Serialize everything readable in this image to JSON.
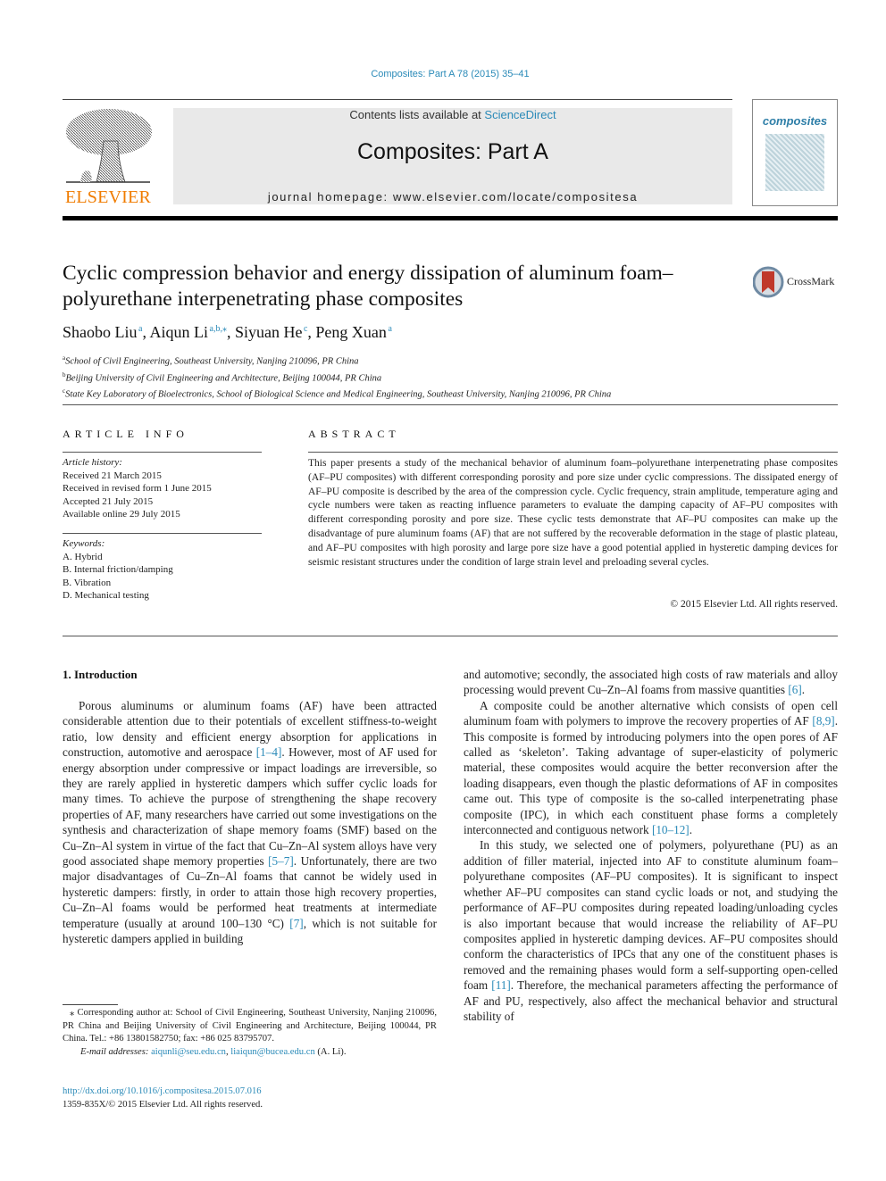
{
  "header": {
    "journal_ref": "Composites: Part A 78 (2015) 35–41",
    "contents_prefix": "Contents lists available at ",
    "contents_link": "ScienceDirect",
    "journal_title": "Composites: Part A",
    "homepage": "journal homepage: www.elsevier.com/locate/compositesa",
    "publisher_logo_text": "ELSEVIER",
    "cover_title": "composites",
    "crossmark_label": "CrossMark",
    "colors": {
      "link": "#2a8ab8",
      "elsevier_orange": "#f07c00",
      "header_bg": "#e9e9e9"
    }
  },
  "article": {
    "title": "Cyclic compression behavior and energy dissipation of aluminum foam–polyurethane interpenetrating phase composites",
    "authors": [
      {
        "name": "Shaobo Liu",
        "sup": "a"
      },
      {
        "name": "Aiqun Li",
        "sup": "a,b,⁎"
      },
      {
        "name": "Siyuan He",
        "sup": "c"
      },
      {
        "name": "Peng Xuan",
        "sup": "a"
      }
    ],
    "affiliations": [
      {
        "key": "a",
        "text": "School of Civil Engineering, Southeast University, Nanjing 210096, PR China"
      },
      {
        "key": "b",
        "text": "Beijing University of Civil Engineering and Architecture, Beijing 100044, PR China"
      },
      {
        "key": "c",
        "text": "State Key Laboratory of Bioelectronics, School of Biological Science and Medical Engineering, Southeast University, Nanjing 210096, PR China"
      }
    ]
  },
  "article_info": {
    "heading": "ARTICLE INFO",
    "history_label": "Article history:",
    "history": [
      "Received 21 March 2015",
      "Received in revised form 1 June 2015",
      "Accepted 21 July 2015",
      "Available online 29 July 2015"
    ],
    "keywords_label": "Keywords:",
    "keywords": [
      "A. Hybrid",
      "B. Internal friction/damping",
      "B. Vibration",
      "D. Mechanical testing"
    ]
  },
  "abstract": {
    "heading": "ABSTRACT",
    "text": "This paper presents a study of the mechanical behavior of aluminum foam–polyurethane interpenetrating phase composites (AF–PU composites) with different corresponding porosity and pore size under cyclic compressions. The dissipated energy of AF–PU composite is described by the area of the compression cycle. Cyclic frequency, strain amplitude, temperature aging and cycle numbers were taken as reacting influence parameters to evaluate the damping capacity of AF–PU composites with different corresponding porosity and pore size. These cyclic tests demonstrate that AF–PU composites can make up the disadvantage of pure aluminum foams (AF) that are not suffered by the recoverable deformation in the stage of plastic plateau, and AF–PU composites with high porosity and large pore size have a good potential applied in hysteretic damping devices for seismic resistant structures under the condition of large strain level and preloading several cycles.",
    "copyright": "© 2015 Elsevier Ltd. All rights reserved."
  },
  "introduction": {
    "heading": "1. Introduction",
    "p1": {
      "a": "Porous aluminums or aluminum foams (AF) have been attracted considerable attention due to their potentials of excellent stiffness-to-weight ratio, low density and efficient energy absorption for applications in construction, automotive and aerospace ",
      "c1": "[1–4]",
      "b": ". However, most of AF used for energy absorption under compressive or impact loadings are irreversible, so they are rarely applied in hysteretic dampers which suffer cyclic loads for many times. To achieve the purpose of strengthening the shape recovery properties of AF, many researchers have carried out some investigations on the synthesis and characterization of shape memory foams (SMF) based on the Cu–Zn–Al system in virtue of the fact that Cu–Zn–Al system alloys have very good associated shape memory properties ",
      "c2": "[5–7]",
      "c": ". Unfortunately, there are two major disadvantages of Cu–Zn–Al foams that cannot be widely used in hysteretic dampers: firstly, in order to attain those high recovery properties, Cu–Zn–Al foams would be performed heat treatments at intermediate temperature (usually at around 100–130 °C) ",
      "c3": "[7]",
      "d": ", which is not suitable for hysteretic dampers applied in building and automotive; secondly, the associated high costs of raw materials and alloy processing would prevent Cu–Zn–Al foams from massive quantities ",
      "c4": "[6]",
      "e": "."
    },
    "p1_left_end": ", which is not suitable for hysteretic dampers applied in building",
    "p1_right_start": "and automotive; secondly, the associated high costs of raw materials and alloy processing would prevent Cu–Zn–Al foams from massive quantities ",
    "p2": {
      "a": "A composite could be another alternative which consists of open cell aluminum foam with polymers to improve the recovery properties of AF ",
      "c1": "[8,9]",
      "b": ". This composite is formed by introducing polymers into the open pores of AF called as ‘skeleton’. Taking advantage of super-elasticity of polymeric material, these composites would acquire the better reconversion after the loading disappears, even though the plastic deformations of AF in composites came out. This type of composite is the so-called interpenetrating phase composite (IPC), in which each constituent phase forms a completely interconnected and contiguous network ",
      "c2": "[10–12]",
      "c": "."
    },
    "p3": {
      "a": "In this study, we selected one of polymers, polyurethane (PU) as an addition of filler material, injected into AF to constitute aluminum foam–polyurethane composites (AF–PU composites). It is significant to inspect whether AF–PU composites can stand cyclic loads or not, and studying the performance of AF–PU composites during repeated loading/unloading cycles is also important because that would increase the reliability of AF–PU composites applied in hysteretic damping devices. AF–PU composites should conform the characteristics of IPCs that any one of the constituent phases is removed and the remaining phases would form a self-supporting open-celled foam ",
      "c1": "[11]",
      "b": ". Therefore, the mechanical parameters affecting the performance of AF and PU, respectively, also affect the mechanical behavior and structural stability of"
    }
  },
  "footnote": {
    "corresponding": "⁎ Corresponding author at: School of Civil Engineering, Southeast University, Nanjing 210096, PR China and Beijing University of Civil Engineering and Architecture, Beijing 100044, PR China. Tel.: +86 13801582750; fax: +86 025 83795707.",
    "email_label": "E-mail addresses: ",
    "email1": "aiqunli@seu.edu.cn",
    "sep": ", ",
    "email2": "liaiqun@bucea.edu.cn",
    "email_suffix": " (A. Li).",
    "doi": "http://dx.doi.org/10.1016/j.compositesa.2015.07.016",
    "issn": "1359-835X/© 2015 Elsevier Ltd. All rights reserved."
  }
}
